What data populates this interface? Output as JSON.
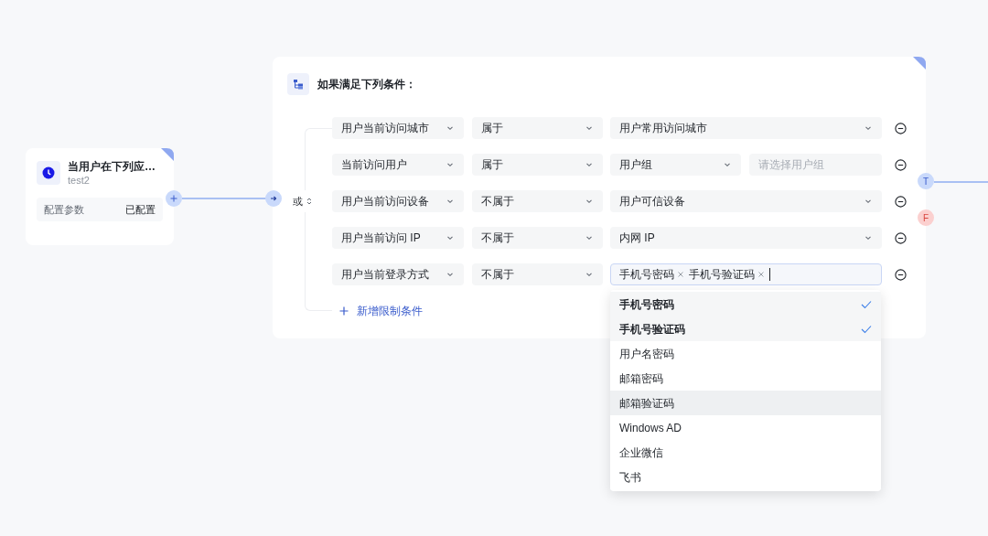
{
  "trigger_node": {
    "title": "当用户在下列应…",
    "subtitle": "test2",
    "param_label": "配置参数",
    "param_value": "已配置"
  },
  "condition_node": {
    "title": "如果满足下列条件：",
    "logic": "或",
    "add_label": "新增限制条件",
    "rows": [
      {
        "kind": "select",
        "field": "用户当前访问城市",
        "operator": "属于",
        "value": "用户常用访问城市"
      },
      {
        "kind": "select_with_input",
        "field": "当前访问用户",
        "operator": "属于",
        "value": "用户组",
        "placeholder": "请选择用户组"
      },
      {
        "kind": "select",
        "field": "用户当前访问设备",
        "operator": "不属于",
        "value": "用户可信设备"
      },
      {
        "kind": "select",
        "field": "用户当前访问 IP",
        "operator": "不属于",
        "value": "内网 IP"
      },
      {
        "kind": "tags",
        "field": "用户当前登录方式",
        "operator": "不属于",
        "tags": [
          "手机号密码",
          "手机号验证码"
        ]
      }
    ]
  },
  "ports": [
    {
      "label": "T",
      "color": "#c9d9fb"
    },
    {
      "label": "F",
      "color": "#fbd0cf"
    }
  ],
  "dropdown": {
    "options": [
      {
        "label": "手机号密码",
        "selected": true,
        "hovered": false
      },
      {
        "label": "手机号验证码",
        "selected": true,
        "hovered": false
      },
      {
        "label": "用户名密码",
        "selected": false,
        "hovered": false
      },
      {
        "label": "邮箱密码",
        "selected": false,
        "hovered": false
      },
      {
        "label": "邮箱验证码",
        "selected": false,
        "hovered": true
      },
      {
        "label": "Windows AD",
        "selected": false,
        "hovered": false
      },
      {
        "label": "企业微信",
        "selected": false,
        "hovered": false
      },
      {
        "label": "飞书",
        "selected": false,
        "hovered": false
      }
    ]
  }
}
